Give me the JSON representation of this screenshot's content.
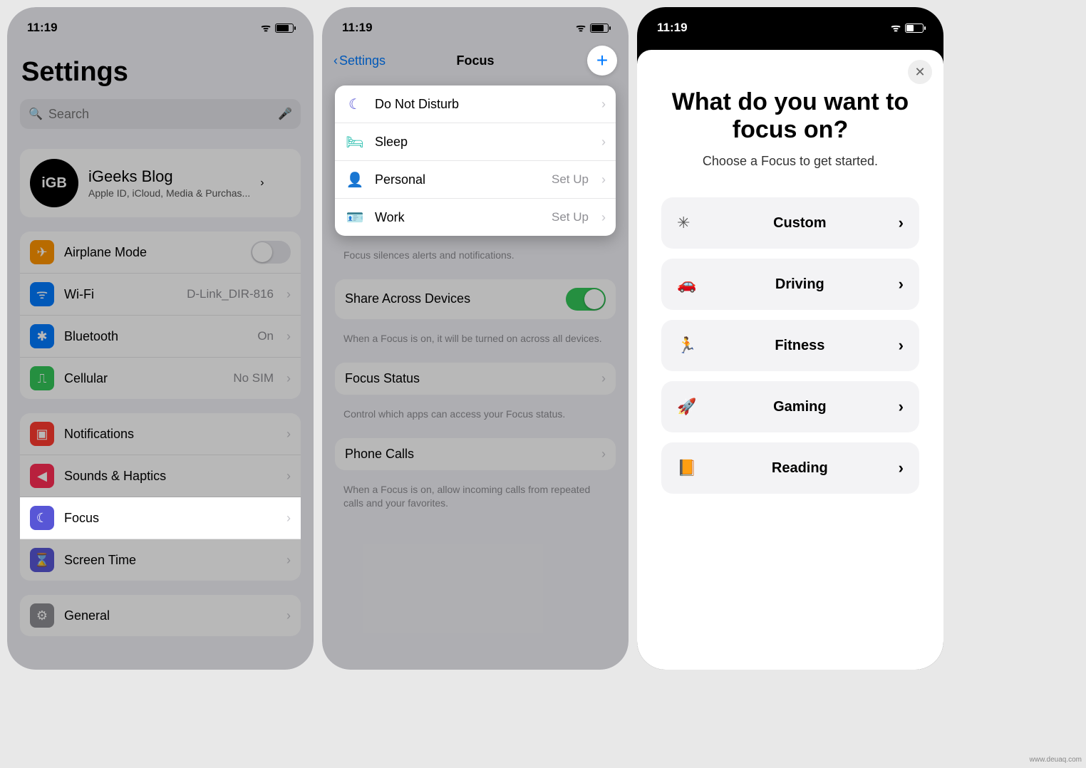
{
  "status_time": "11:19",
  "watermark": "www.deuaq.com",
  "p1": {
    "title": "Settings",
    "search_placeholder": "Search",
    "account": {
      "avatar": "iGB",
      "name": "iGeeks Blog",
      "sub": "Apple ID, iCloud, Media & Purchas..."
    },
    "rows1": [
      {
        "icon": "✈︎",
        "bg": "#ff9500",
        "label": "Airplane Mode",
        "type": "toggle"
      },
      {
        "icon": "ᯤ",
        "bg": "#007aff",
        "label": "Wi-Fi",
        "value": "D-Link_DIR-816"
      },
      {
        "icon": "✱",
        "bg": "#007aff",
        "label": "Bluetooth",
        "value": "On"
      },
      {
        "icon": "⎍",
        "bg": "#34c759",
        "label": "Cellular",
        "value": "No SIM"
      }
    ],
    "rows2": [
      {
        "icon": "▣",
        "bg": "#ff3b30",
        "label": "Notifications"
      },
      {
        "icon": "◀",
        "bg": "#ff2d55",
        "label": "Sounds & Haptics"
      },
      {
        "icon": "☾",
        "bg": "#5856d6",
        "label": "Focus",
        "highlight": true
      },
      {
        "icon": "⌛",
        "bg": "#5856d6",
        "label": "Screen Time"
      }
    ],
    "rows3": [
      {
        "icon": "⚙",
        "bg": "#8e8e93",
        "label": "General"
      }
    ]
  },
  "p2": {
    "back": "Settings",
    "title": "Focus",
    "focus_items": [
      {
        "icon": "☾",
        "color": "#5856d6",
        "label": "Do Not Disturb"
      },
      {
        "icon": "🛏",
        "color": "#14b8a6",
        "label": "Sleep"
      },
      {
        "icon": "👤",
        "color": "#af52de",
        "label": "Personal",
        "value": "Set Up"
      },
      {
        "icon": "🪪",
        "color": "#30b0c7",
        "label": "Work",
        "value": "Set Up"
      }
    ],
    "note1": "Focus silences alerts and notifications.",
    "share_label": "Share Across Devices",
    "note2": "When a Focus is on, it will be turned on across all devices.",
    "status_label": "Focus Status",
    "note3": "Control which apps can access your Focus status.",
    "phone_label": "Phone Calls",
    "note4": "When a Focus is on, allow incoming calls from repeated calls and your favorites."
  },
  "p3": {
    "heading": "What do you want to focus on?",
    "sub": "Choose a Focus to get started.",
    "options": [
      {
        "icon": "✳",
        "color": "#555",
        "label": "Custom"
      },
      {
        "icon": "🚗",
        "color": "#5856d6",
        "label": "Driving"
      },
      {
        "icon": "🏃",
        "color": "#34c759",
        "label": "Fitness"
      },
      {
        "icon": "🚀",
        "color": "#0a84ff",
        "label": "Gaming"
      },
      {
        "icon": "📙",
        "color": "#ff9500",
        "label": "Reading"
      }
    ]
  }
}
